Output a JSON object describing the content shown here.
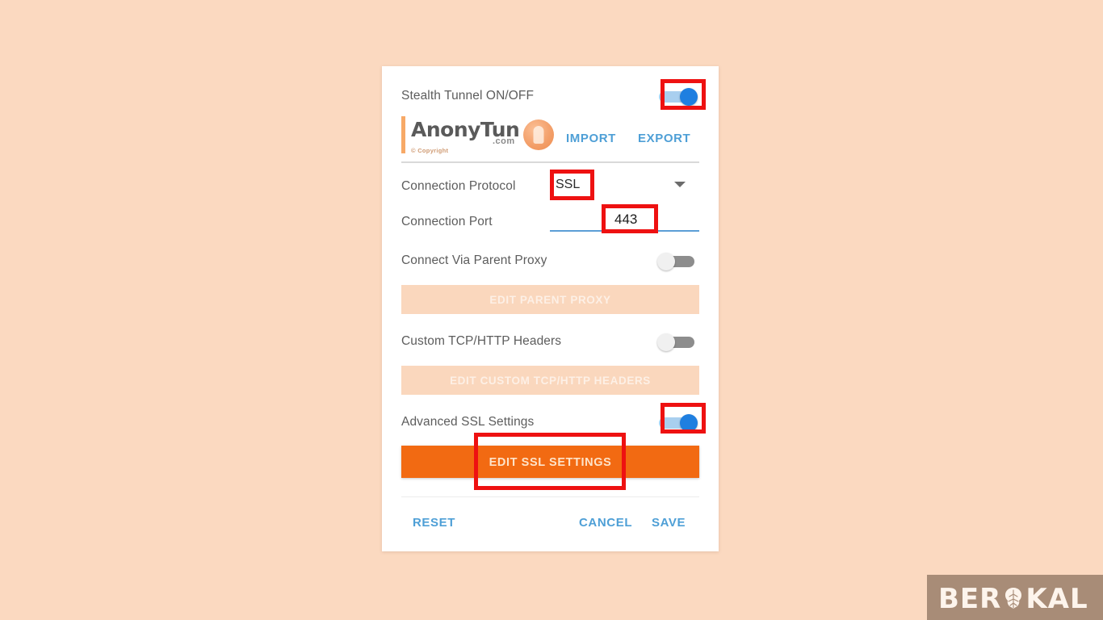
{
  "page": {
    "background_color": "#fbd9c0",
    "card_background": "#ffffff"
  },
  "app": {
    "stealth_tunnel": {
      "label": "Stealth Tunnel ON/OFF",
      "state": "on",
      "toggle_name": "stealth-tunnel-toggle"
    },
    "brand": {
      "wordmark": "AnonyTun",
      "domain": ".com",
      "copyright": "© Copyright",
      "badge_icon": "anonytun-shield-icon"
    },
    "actions": {
      "import_label": "IMPORT",
      "export_label": "EXPORT",
      "link_color": "#4e9fd6"
    },
    "connection_protocol": {
      "label": "Connection Protocol",
      "value": "SSL",
      "dropdown_icon": "chevron-down-icon"
    },
    "connection_port": {
      "label": "Connection Port",
      "value": "443",
      "underline_color": "#5c9ed6"
    },
    "parent_proxy": {
      "label": "Connect Via Parent Proxy",
      "state": "off",
      "button_label": "EDIT PARENT PROXY",
      "button_enabled": false,
      "disabled_bg": "#fad7bd"
    },
    "custom_headers": {
      "label": "Custom TCP/HTTP Headers",
      "state": "off",
      "button_label": "EDIT CUSTOM TCP/HTTP HEADERS",
      "button_enabled": false
    },
    "advanced_ssl": {
      "label": "Advanced SSL Settings",
      "state": "on",
      "button_label": "EDIT SSL SETTINGS",
      "button_enabled": true,
      "button_color": "#f26a12"
    },
    "footer": {
      "reset_label": "RESET",
      "cancel_label": "CANCEL",
      "save_label": "SAVE"
    }
  },
  "annotations": {
    "color": "#ee1111",
    "boxes": [
      {
        "name": "annot-stealth-toggle"
      },
      {
        "name": "annot-protocol-value"
      },
      {
        "name": "annot-port-value"
      },
      {
        "name": "annot-advanced-ssl-toggle"
      },
      {
        "name": "annot-edit-ssl-button"
      }
    ]
  },
  "watermark": {
    "text_before": "BER",
    "icon": "brain-icon",
    "text_after": "KAL",
    "background_color": "#a88c77"
  }
}
